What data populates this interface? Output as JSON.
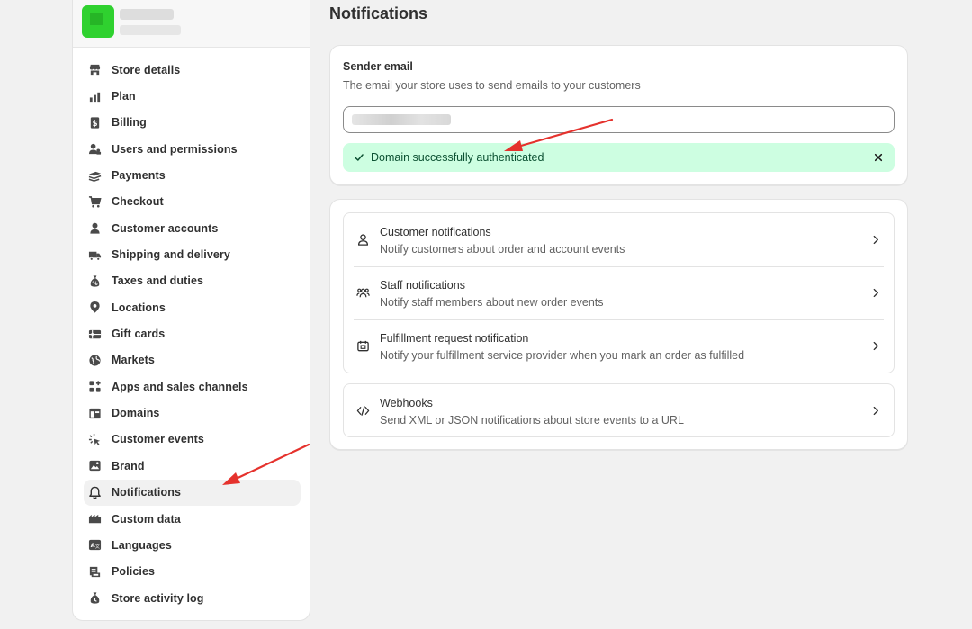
{
  "sidebar": {
    "items": [
      {
        "label": "Store details",
        "icon": "store-icon"
      },
      {
        "label": "Plan",
        "icon": "plan-icon"
      },
      {
        "label": "Billing",
        "icon": "billing-icon"
      },
      {
        "label": "Users and permissions",
        "icon": "users-icon"
      },
      {
        "label": "Payments",
        "icon": "payments-icon"
      },
      {
        "label": "Checkout",
        "icon": "cart-icon"
      },
      {
        "label": "Customer accounts",
        "icon": "person-icon"
      },
      {
        "label": "Shipping and delivery",
        "icon": "truck-icon"
      },
      {
        "label": "Taxes and duties",
        "icon": "money-bag-icon"
      },
      {
        "label": "Locations",
        "icon": "location-icon"
      },
      {
        "label": "Gift cards",
        "icon": "gift-card-icon"
      },
      {
        "label": "Markets",
        "icon": "globe-icon"
      },
      {
        "label": "Apps and sales channels",
        "icon": "apps-icon"
      },
      {
        "label": "Domains",
        "icon": "domain-icon"
      },
      {
        "label": "Customer events",
        "icon": "events-icon"
      },
      {
        "label": "Brand",
        "icon": "brand-icon"
      },
      {
        "label": "Notifications",
        "icon": "bell-icon",
        "active": true
      },
      {
        "label": "Custom data",
        "icon": "custom-data-icon"
      },
      {
        "label": "Languages",
        "icon": "language-icon"
      },
      {
        "label": "Policies",
        "icon": "policy-icon"
      },
      {
        "label": "Store activity log",
        "icon": "activity-log-icon"
      }
    ]
  },
  "main": {
    "title": "Notifications",
    "sender": {
      "title": "Sender email",
      "description": "The email your store uses to send emails to your customers",
      "banner_text": "Domain successfully authenticated"
    },
    "groups": [
      [
        {
          "title": "Customer notifications",
          "desc": "Notify customers about order and account events",
          "icon": "person-outline-icon"
        },
        {
          "title": "Staff notifications",
          "desc": "Notify staff members about new order events",
          "icon": "team-icon"
        },
        {
          "title": "Fulfillment request notification",
          "desc": "Notify your fulfillment service provider when you mark an order as fulfilled",
          "icon": "fulfillment-icon"
        }
      ],
      [
        {
          "title": "Webhooks",
          "desc": "Send XML or JSON notifications about store events to a URL",
          "icon": "code-icon"
        }
      ]
    ]
  },
  "colors": {
    "banner_bg": "#cdfee1",
    "banner_text": "#0c5132",
    "annotation_arrow": "#e5322d"
  }
}
